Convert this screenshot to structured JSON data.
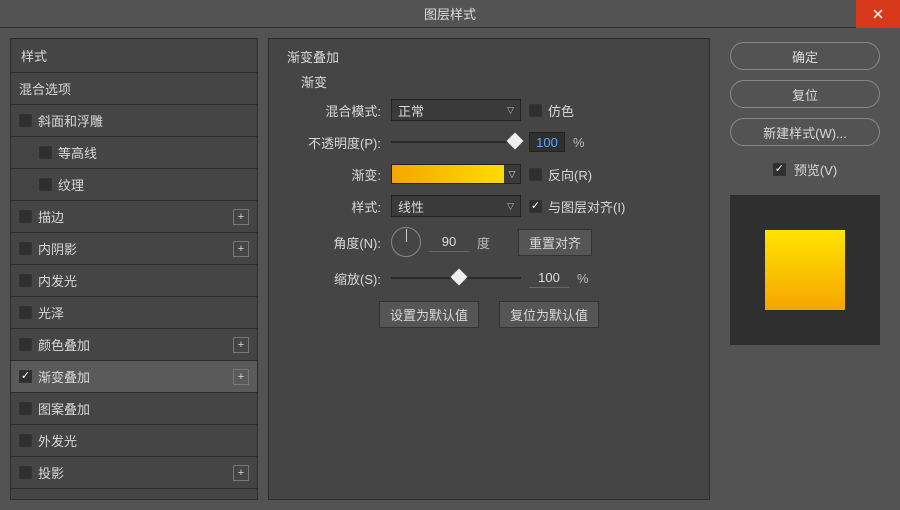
{
  "window": {
    "title": "图层样式"
  },
  "sidebar": {
    "header": "样式",
    "blending": "混合选项",
    "items": [
      {
        "label": "斜面和浮雕",
        "checked": false,
        "plus": false
      },
      {
        "label": "等高线",
        "checked": false,
        "plus": false,
        "sub": true
      },
      {
        "label": "纹理",
        "checked": false,
        "plus": false,
        "sub": true
      },
      {
        "label": "描边",
        "checked": false,
        "plus": true
      },
      {
        "label": "内阴影",
        "checked": false,
        "plus": true
      },
      {
        "label": "内发光",
        "checked": false,
        "plus": false
      },
      {
        "label": "光泽",
        "checked": false,
        "plus": false
      },
      {
        "label": "颜色叠加",
        "checked": false,
        "plus": true
      },
      {
        "label": "渐变叠加",
        "checked": true,
        "plus": true
      },
      {
        "label": "图案叠加",
        "checked": false,
        "plus": false
      },
      {
        "label": "外发光",
        "checked": false,
        "plus": false
      },
      {
        "label": "投影",
        "checked": false,
        "plus": true
      }
    ]
  },
  "panel": {
    "title": "渐变叠加",
    "subtitle": "渐变",
    "blendModeLabel": "混合模式:",
    "blendModeValue": "正常",
    "ditherLabel": "仿色",
    "opacityLabel": "不透明度(P):",
    "opacityValue": "100",
    "percent": "%",
    "gradientLabel": "渐变:",
    "reverseLabel": "反向(R)",
    "styleLabel": "样式:",
    "styleValue": "线性",
    "alignLabel": "与图层对齐(I)",
    "angleLabel": "角度(N):",
    "angleValue": "90",
    "angleUnit": "度",
    "resetAlign": "重置对齐",
    "scaleLabel": "缩放(S):",
    "scaleValue": "100",
    "setDefault": "设置为默认值",
    "resetDefault": "复位为默认值"
  },
  "right": {
    "ok": "确定",
    "reset": "复位",
    "newStyle": "新建样式(W)...",
    "preview": "预览(V)"
  }
}
